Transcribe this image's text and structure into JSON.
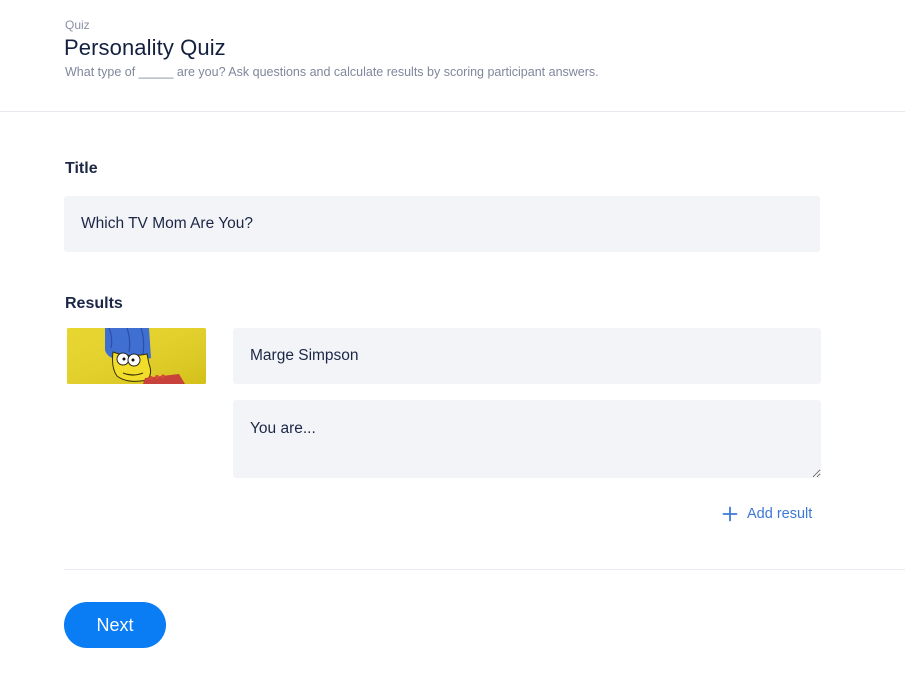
{
  "header": {
    "eyebrow": "Quiz",
    "title": "Personality Quiz",
    "subtitle": "What type of _____ are you? Ask questions and calculate results by scoring participant answers."
  },
  "title_section": {
    "label": "Title",
    "value": "Which TV Mom Are You?"
  },
  "results_section": {
    "label": "Results",
    "items": [
      {
        "name": "Marge Simpson",
        "description": "You are..."
      }
    ],
    "add_label": "Add result"
  },
  "footer": {
    "next_label": "Next"
  },
  "colors": {
    "accent": "#0a7cf4",
    "link": "#3c78d8",
    "field_bg": "#f3f4f8"
  },
  "icons": {
    "add": "plus-icon"
  }
}
